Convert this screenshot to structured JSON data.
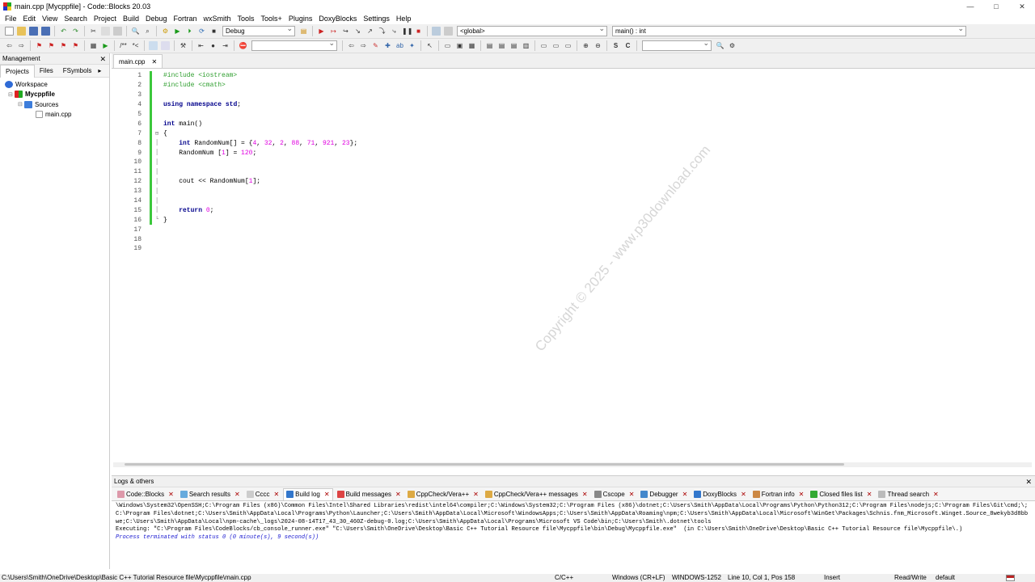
{
  "window": {
    "title": "main.cpp [Mycppfile] - Code::Blocks 20.03",
    "controls": [
      "—",
      "□",
      "✕"
    ]
  },
  "menu": [
    "File",
    "Edit",
    "View",
    "Search",
    "Project",
    "Build",
    "Debug",
    "Fortran",
    "wxSmith",
    "Tools",
    "Tools+",
    "Plugins",
    "DoxyBlocks",
    "Settings",
    "Help"
  ],
  "toolbar": {
    "build_target": "Debug",
    "scope": "<global>",
    "function": "main() : int"
  },
  "management": {
    "title": "Management",
    "tabs": [
      "Projects",
      "Files",
      "FSymbols"
    ],
    "tree": {
      "workspace": "Workspace",
      "project": "Mycppfile",
      "folder": "Sources",
      "file": "main.cpp"
    }
  },
  "editor": {
    "tab": "main.cpp",
    "lines": [
      {
        "n": "1",
        "text": "#include <iostream>"
      },
      {
        "n": "2",
        "text": "#include <cmath>"
      },
      {
        "n": "3",
        "text": ""
      },
      {
        "n": "4",
        "text": "using namespace std;"
      },
      {
        "n": "5",
        "text": ""
      },
      {
        "n": "6",
        "text": "int main()"
      },
      {
        "n": "7",
        "text": "{"
      },
      {
        "n": "8",
        "text": "    int RandomNum[] = {4, 32, 2, 88, 71, 921, 23};"
      },
      {
        "n": "9",
        "text": "    RandomNum [1] = 120;"
      },
      {
        "n": "10",
        "text": ""
      },
      {
        "n": "11",
        "text": ""
      },
      {
        "n": "12",
        "text": "    cout << RandomNum[1];"
      },
      {
        "n": "13",
        "text": ""
      },
      {
        "n": "14",
        "text": ""
      },
      {
        "n": "15",
        "text": "    return 0;"
      },
      {
        "n": "16",
        "text": "}"
      },
      {
        "n": "17",
        "text": ""
      },
      {
        "n": "18",
        "text": ""
      },
      {
        "n": "19",
        "text": ""
      }
    ],
    "watermark": "Copyright © 2025 - www.p30download.com"
  },
  "logs": {
    "title": "Logs & others",
    "tabs": [
      "Code::Blocks",
      "Search results",
      "Cccc",
      "Build log",
      "Build messages",
      "CppCheck/Vera++",
      "CppCheck/Vera++ messages",
      "Cscope",
      "Debugger",
      "DoxyBlocks",
      "Fortran info",
      "Closed files list",
      "Thread search"
    ],
    "text": "\\Windows\\System32\\OpenSSH;C:\\Program Files (x86)\\Common Files\\Intel\\Shared Libraries\\redist\\intel64\\compiler;C:\\Windows\\System32;C:\\Program Files (x86)\\dotnet;C:\\Users\\Smith\\AppData\\Local\\Programs\\Python\\Python312;C:\\Program Files\\nodejs;C:\\Program Files\\Git\\cmd;\\;C:\\Program Files\\dotnet;C:\\Users\\Smith\\AppData\\Local\\Programs\\Python\\Launcher;C:\\Users\\Smith\\AppData\\Local\\Microsoft\\WindowsApps;C:\\Users\\Smith\\AppData\\Roaming\\npm;C:\\Users\\Smith\\AppData\\Local\\Microsoft\\WinGet\\Packages\\Schnis.fnm_Microsoft.Winget.Source_8wekyb3d8bbwe;C:\\Users\\Smith\\AppData\\Local\\npm-cache\\_logs\\2024-08-14T17_43_30_460Z-debug-0.log;C:\\Users\\Smith\\AppData\\Local\\Programs\\Microsoft VS Code\\bin;C:\\Users\\Smith\\.dotnet\\tools\nExecuting: \"C:\\Program Files\\CodeBlocks/cb_console_runner.exe\" \"C:\\Users\\Smith\\OneDrive\\Desktop\\Basic C++ Tutorial Resource file\\Mycppfile\\bin\\Debug\\Mycppfile.exe\"  (in C:\\Users\\Smith\\OneDrive\\Desktop\\Basic C++ Tutorial Resource file\\Mycppfile\\.)",
    "status_line": "Process terminated with status 0 (0 minute(s), 9 second(s))"
  },
  "status": {
    "path": "C:\\Users\\Smith\\OneDrive\\Desktop\\Basic C++ Tutorial Resource file\\Mycppfile\\main.cpp",
    "lang": "C/C++",
    "eol": "Windows (CR+LF)",
    "encoding": "WINDOWS-1252",
    "position": "Line 10, Col 1, Pos 158",
    "mode": "Insert",
    "access": "Read/Write",
    "profile": "default"
  }
}
